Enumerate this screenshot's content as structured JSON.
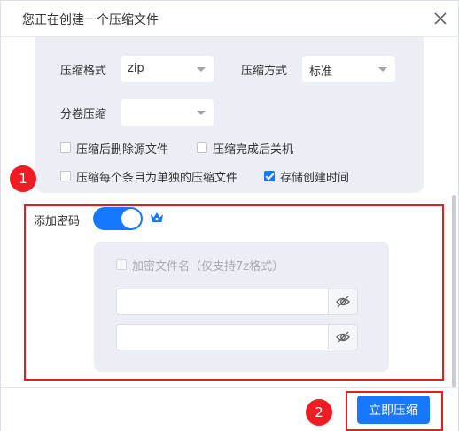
{
  "dialog": {
    "title": "您正在创建一个压缩文件"
  },
  "options": {
    "format_label": "压缩格式",
    "format_value": "zip",
    "method_label": "压缩方式",
    "method_value": "标准",
    "split_label": "分卷压缩",
    "split_value": "",
    "checkboxes": [
      {
        "label": "压缩后删除源文件",
        "checked": false
      },
      {
        "label": "压缩完成后关机",
        "checked": false
      },
      {
        "label": "压缩每个条目为单独的压缩文件",
        "checked": false
      },
      {
        "label": "存储创建时间",
        "checked": true
      }
    ]
  },
  "password": {
    "label": "添加密码",
    "enabled": true,
    "encrypt_names_label": "加密文件名（仅支持7z格式）",
    "encrypt_names_checked": false,
    "password_value": "",
    "confirm_value": ""
  },
  "annotations": {
    "badge_1": "1",
    "badge_2": "2",
    "highlight_color": "#e02020"
  },
  "footer": {
    "compress_label": "立即压缩"
  },
  "colors": {
    "accent": "#1677ff",
    "panel": "#eceef5"
  },
  "icons": [
    "close-icon",
    "chevron-down-icon",
    "crown-icon",
    "eye-off-icon",
    "checkbox-check-icon"
  ]
}
